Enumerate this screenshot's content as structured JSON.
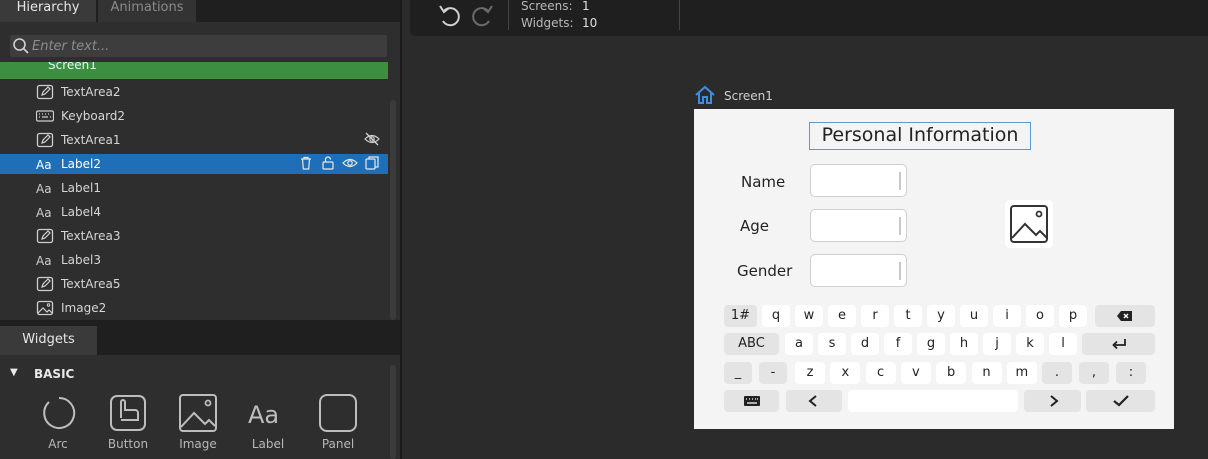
{
  "tabs": {
    "hierarchy": "Hierarchy",
    "animations": "Animations"
  },
  "search": {
    "placeholder": "Enter text..."
  },
  "tree": {
    "screen": "Screen1",
    "items": [
      {
        "label": "TextArea2",
        "icon": "textarea-icon"
      },
      {
        "label": "Keyboard2",
        "icon": "keyboard-icon"
      },
      {
        "label": "TextArea1",
        "icon": "textarea-icon",
        "hidden": true
      },
      {
        "label": "Label2",
        "icon": "label-icon",
        "selected": true
      },
      {
        "label": "Label1",
        "icon": "label-icon"
      },
      {
        "label": "Label4",
        "icon": "label-icon"
      },
      {
        "label": "TextArea3",
        "icon": "textarea-icon"
      },
      {
        "label": "Label3",
        "icon": "label-icon"
      },
      {
        "label": "TextArea5",
        "icon": "textarea-icon"
      },
      {
        "label": "Image2",
        "icon": "image-icon"
      }
    ]
  },
  "widgets": {
    "tab": "Widgets",
    "section": "BASIC",
    "items": [
      "Arc",
      "Button",
      "Image",
      "Label",
      "Panel"
    ]
  },
  "toolbar": {
    "screens_label": "Screens:",
    "screens_value": "1",
    "widgets_label": "Widgets:",
    "widgets_value": "10"
  },
  "canvas": {
    "screen_name": "Screen1",
    "title": "Personal Information",
    "fields": [
      "Name",
      "Age",
      "Gender"
    ]
  },
  "keyboard": {
    "row1": [
      "1#",
      "q",
      "w",
      "e",
      "r",
      "t",
      "y",
      "u",
      "i",
      "o",
      "p"
    ],
    "row2": [
      "ABC",
      "a",
      "s",
      "d",
      "f",
      "g",
      "h",
      "j",
      "k",
      "l"
    ],
    "row3": [
      "_",
      "-",
      "z",
      "x",
      "c",
      "v",
      "b",
      "n",
      "m",
      ".",
      ",",
      ":"
    ]
  },
  "colors": {
    "accent": "#1f6fb8",
    "screen_row": "#3e8e41",
    "canvas_bg": "#f4f4f4"
  }
}
